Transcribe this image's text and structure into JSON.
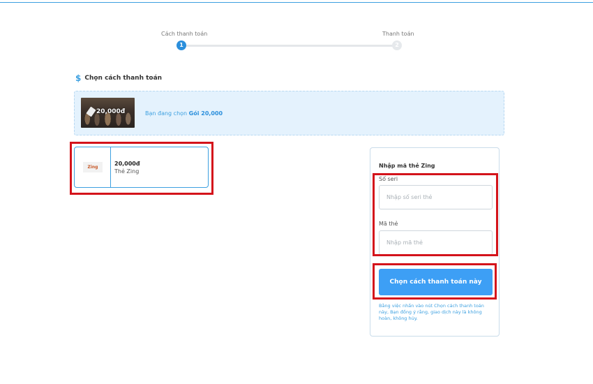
{
  "stepper": {
    "step1_label": "Cách thanh toán",
    "step1_number": "1",
    "step2_label": "Thanh toán",
    "step2_number": "2"
  },
  "section": {
    "icon": "dollar-icon",
    "title": "Chọn cách thanh toán"
  },
  "package": {
    "thumb_price": "20,000đ",
    "text_prefix": "Bạn đang chọn ",
    "text_package": "Gói 20,000"
  },
  "method": {
    "logo_text": "Zing",
    "price": "20,000đ",
    "name": "Thẻ Zing"
  },
  "card_form": {
    "title": "Nhập mã thẻ Zing",
    "serial_label": "Số seri",
    "serial_placeholder": "Nhập số seri thẻ",
    "code_label": "Mã thẻ",
    "code_placeholder": "Nhập mã thẻ",
    "submit_label": "Chọn cách thanh toán này",
    "disclaimer": "Bằng việc nhấn vào nút Chọn cách thanh toán này, Bạn đồng ý rằng, giao dịch này là không hoàn, không hủy."
  },
  "colors": {
    "accent": "#3da0e0",
    "button": "#3d9ff5",
    "annotation": "#d4131b",
    "banner_bg": "#e4f2fd"
  }
}
